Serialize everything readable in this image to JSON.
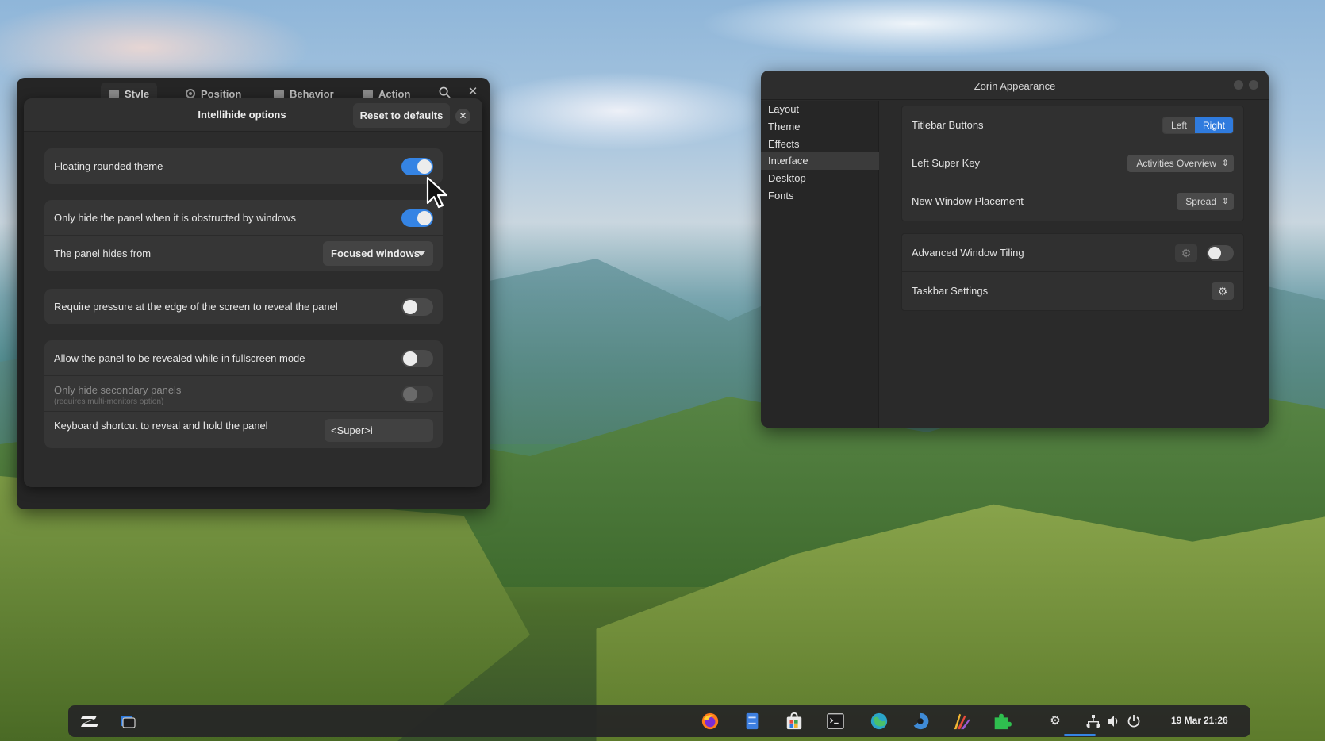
{
  "prefs_window": {
    "tabs": [
      {
        "label": "Style",
        "icon": "style-icon"
      },
      {
        "label": "Position",
        "icon": "position-icon"
      },
      {
        "label": "Behavior",
        "icon": "behavior-icon"
      },
      {
        "label": "Action",
        "icon": "action-icon"
      }
    ],
    "dialog": {
      "title": "Intellihide options",
      "reset_label": "Reset to defaults",
      "rows": {
        "floating": {
          "label": "Floating rounded theme",
          "on": true
        },
        "obstructed": {
          "label": "Only hide the panel when it is obstructed by windows",
          "on": true
        },
        "hides_from": {
          "label": "The panel hides from",
          "value": "Focused windows"
        },
        "pressure": {
          "label": "Require pressure at the edge of the screen to reveal the panel",
          "on": false
        },
        "fullscreen": {
          "label": "Allow the panel to be revealed while in fullscreen mode",
          "on": false
        },
        "secondary": {
          "label": "Only hide secondary panels",
          "sublabel": "(requires multi-monitors option)",
          "on": false
        },
        "shortcut": {
          "label": "Keyboard shortcut to reveal and hold the panel",
          "value": "<Super>i"
        }
      }
    }
  },
  "appearance_window": {
    "title": "Zorin Appearance",
    "sidebar": [
      "Layout",
      "Theme",
      "Effects",
      "Interface",
      "Desktop",
      "Fonts"
    ],
    "active_sidebar": "Interface",
    "rows": {
      "titlebar_buttons": {
        "label": "Titlebar Buttons",
        "options": [
          "Left",
          "Right"
        ],
        "selected": "Right"
      },
      "left_super_key": {
        "label": "Left Super Key",
        "value": "Activities Overview"
      },
      "new_window_placement": {
        "label": "New Window Placement",
        "value": "Spread"
      },
      "advanced_tiling": {
        "label": "Advanced Window Tiling",
        "on": false
      },
      "taskbar_settings": {
        "label": "Taskbar Settings"
      }
    }
  },
  "taskbar": {
    "date": "19 Mar",
    "time": "21:26"
  },
  "colors": {
    "accent": "#3584e4",
    "segment_selected": "#2f7bde"
  }
}
